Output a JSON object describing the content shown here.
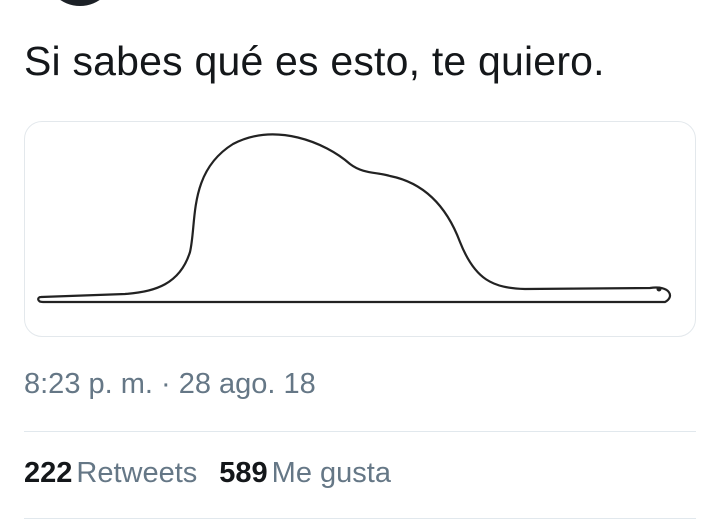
{
  "tweet": {
    "text": "Si sabes qué es esto, te quiero.",
    "timestamp": "8:23 p. m. · 28 ago. 18",
    "media": {
      "description_icon": "boa-swallowing-elephant-drawing"
    }
  },
  "stats": {
    "retweets_count": "222",
    "retweets_label": "Retweets",
    "likes_count": "589",
    "likes_label": "Me gusta"
  },
  "colors": {
    "text_primary": "#14171a",
    "text_secondary": "#657786",
    "divider": "#e1e8ed",
    "card_border": "#e3e8ec"
  }
}
